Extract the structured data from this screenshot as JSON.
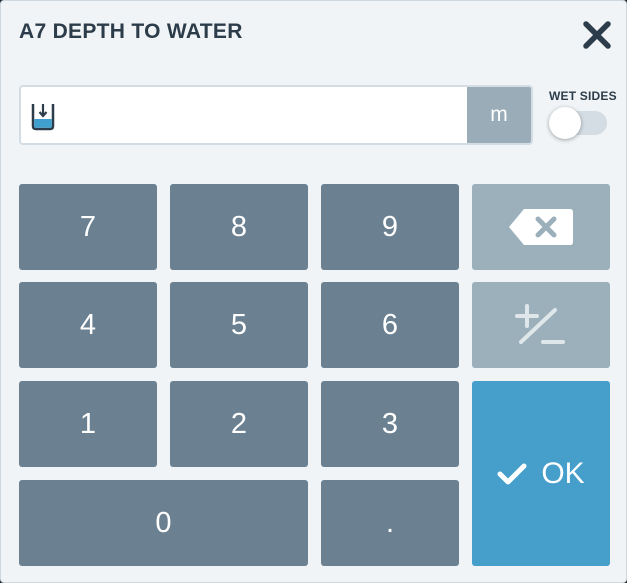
{
  "dialog": {
    "title": "A7 DEPTH TO WATER",
    "close_icon": "close-icon"
  },
  "input": {
    "icon": "depth-to-water-icon",
    "value": "",
    "unit": "m"
  },
  "wet_sides": {
    "label": "WET SIDES",
    "on": false
  },
  "keypad": {
    "k7": "7",
    "k8": "8",
    "k9": "9",
    "k4": "4",
    "k5": "5",
    "k6": "6",
    "k1": "1",
    "k2": "2",
    "k3": "3",
    "k0": "0",
    "dot": ".",
    "backspace_icon": "backspace-icon",
    "plus_minus_icon": "plus-minus-icon",
    "ok_label": "OK",
    "ok_icon": "checkmark-icon"
  },
  "colors": {
    "key": "#6b8191",
    "key_light": "#9bb0bb",
    "ok": "#469ecb",
    "title": "#2d3c4a",
    "water": "#3fa0d0"
  }
}
